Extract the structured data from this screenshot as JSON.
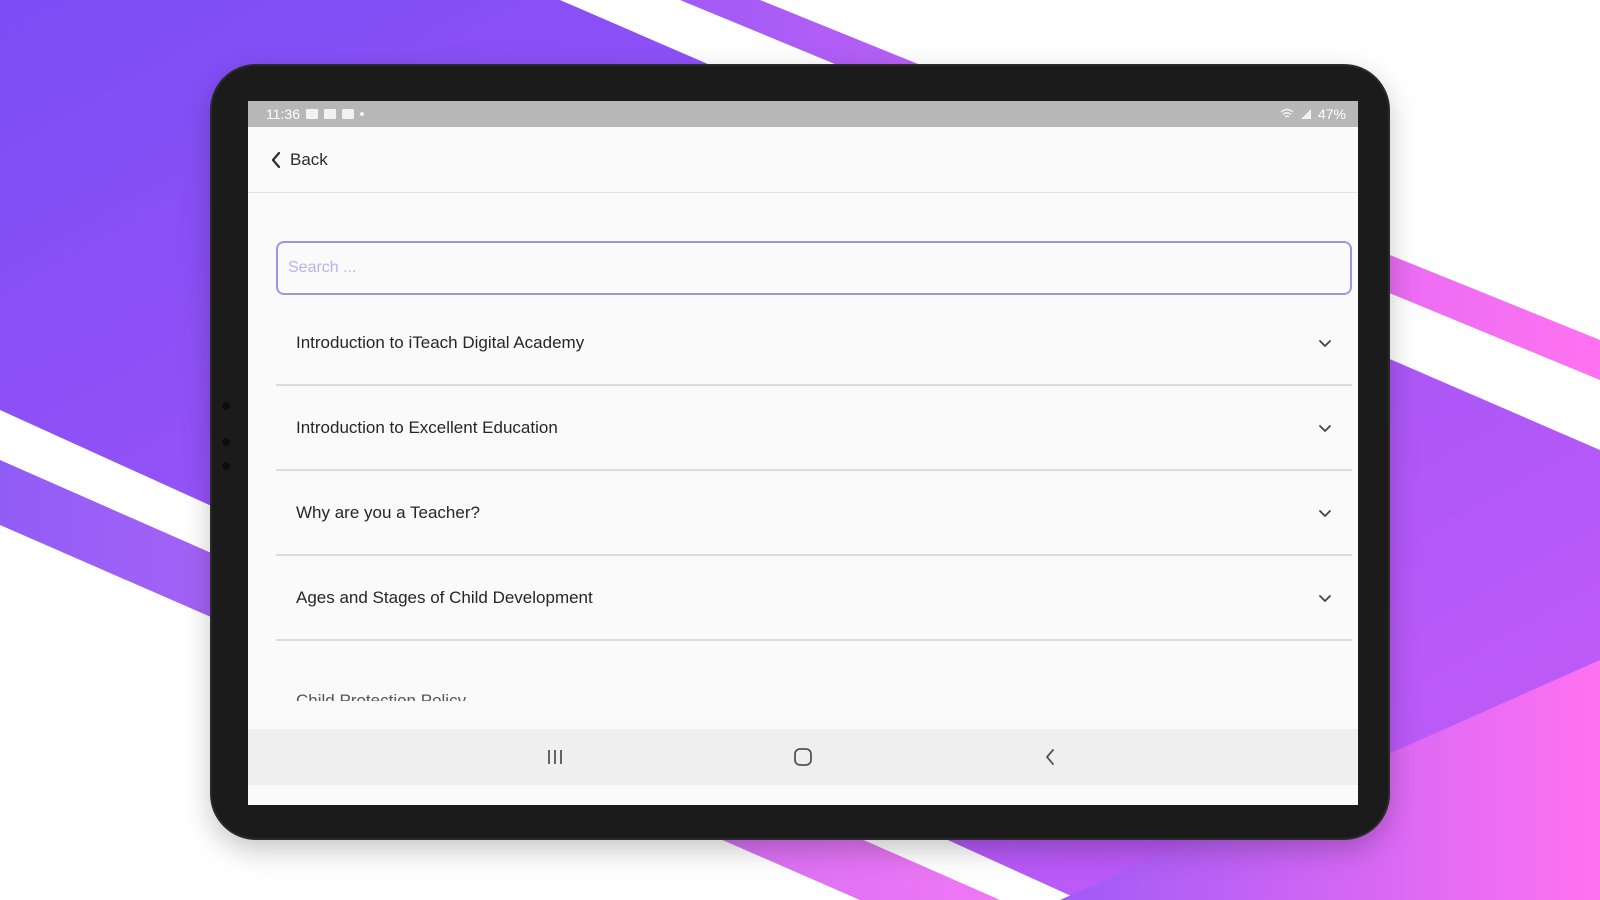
{
  "colors": {
    "gradient_start": "#7a4cf5",
    "gradient_end": "#f86ef5",
    "search_border": "#9b97e8",
    "search_placeholder": "#b8b3f0",
    "statusbar": "#b7b7b7",
    "tablet_frame": "#1b1b1b"
  },
  "statusbar": {
    "time": "11:36",
    "battery": "47%",
    "left_icons": [
      "image-icon",
      "check-icon",
      "message-icon",
      "dot-icon"
    ],
    "right_icons": [
      "wifi-icon",
      "signal-icon"
    ]
  },
  "header": {
    "back_label": "Back",
    "back_icon": "chevron-left-icon"
  },
  "search": {
    "placeholder": "Search ...",
    "value": ""
  },
  "topics": {
    "items": [
      {
        "label": "Introduction to iTeach Digital Academy"
      },
      {
        "label": "Introduction to Excellent Education"
      },
      {
        "label": "Why are you a Teacher?"
      },
      {
        "label": "Ages and Stages of Child Development"
      },
      {
        "label": "Child Protection Policy"
      }
    ],
    "expand_icon": "chevron-down-icon"
  },
  "navbar": {
    "icons": [
      "recent-apps-icon",
      "home-icon",
      "back-icon"
    ]
  }
}
